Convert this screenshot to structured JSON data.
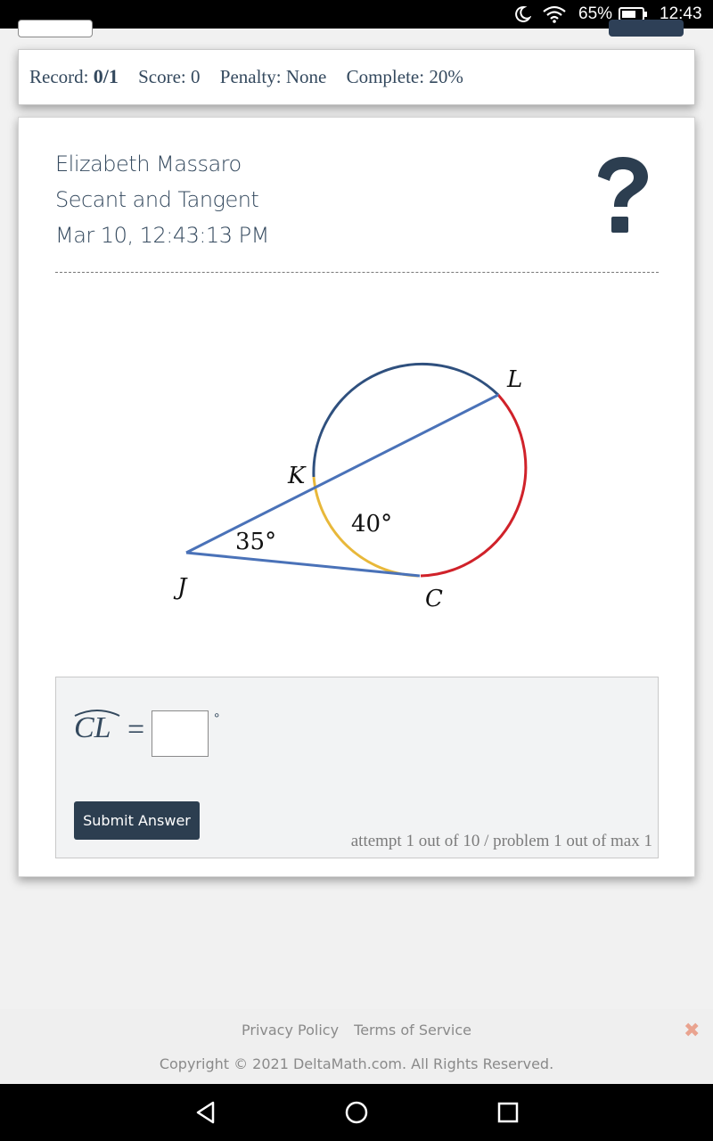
{
  "status_bar": {
    "battery_percent": "65%",
    "time": "12:43",
    "icons": [
      "moon-icon",
      "wifi-icon",
      "battery-icon"
    ]
  },
  "record_bar": {
    "record_label": "Record:",
    "record_value": "0/1",
    "score": "Score: 0",
    "penalty": "Penalty: None",
    "complete": "Complete: 20%"
  },
  "problem": {
    "student_name": "Elizabeth Massaro",
    "topic": "Secant and Tangent",
    "timestamp": "Mar 10, 12:43:13 PM",
    "help_icon": "question-mark-icon"
  },
  "diagram": {
    "points": {
      "J": "J",
      "K": "K",
      "L": "L",
      "C": "C"
    },
    "angle_label": "35°",
    "arc_label": "40°",
    "colors": {
      "secant_tangent": "#4a72b8",
      "arc_KL_major": "#2f507e",
      "arc_KC": "#e8b83a",
      "arc_CL": "#d0222a"
    }
  },
  "answer": {
    "variable": "CL",
    "equals": "=",
    "input_value": "",
    "unit": "°",
    "submit_label": "Submit Answer",
    "attempt_text": "attempt 1 out of 10 / problem 1 out of max 1"
  },
  "footer": {
    "privacy": "Privacy Policy",
    "terms": "Terms of Service",
    "copyright": "Copyright © 2021 DeltaMath.com. All Rights Reserved.",
    "close": "✖"
  },
  "nav_bar": {
    "buttons": [
      "back-icon",
      "home-icon",
      "recents-icon"
    ]
  },
  "colors": {
    "primary_dark": "#2c3e50",
    "status_bar": "#000000"
  }
}
